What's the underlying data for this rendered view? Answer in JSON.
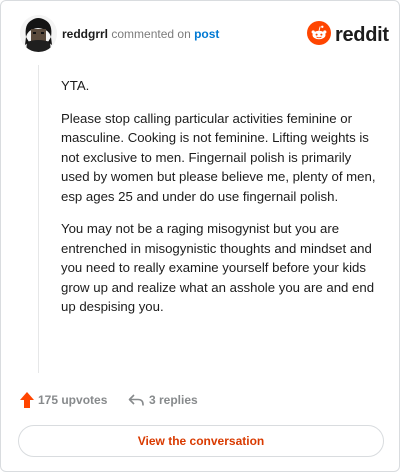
{
  "comment": {
    "username": "reddgrrl",
    "action_text": "commented on",
    "post_link": "post",
    "paragraphs": [
      "YTA.",
      "Please stop calling particular activities feminine or masculine. Cooking is not feminine. Lifting weights is not exclusive to men. Fingernail polish is primarily used by women but please believe me, plenty of men, esp ages 25 and under do use fingernail polish.",
      "You may not be a raging misogynist but you are entrenched in misogynistic thoughts and mindset and you need to really examine yourself before your kids grow up and realize what an asshole you are and end up despising you."
    ]
  },
  "brand": {
    "word": "reddit",
    "color": "#ff4500"
  },
  "actions": {
    "upvotes": "175 upvotes",
    "replies": "3 replies"
  },
  "footer": {
    "view_button": "View the conversation"
  },
  "colors": {
    "upvote": "#ff4500",
    "link": "#0079d3",
    "button_text": "#d93a00",
    "muted": "#878a8c"
  }
}
